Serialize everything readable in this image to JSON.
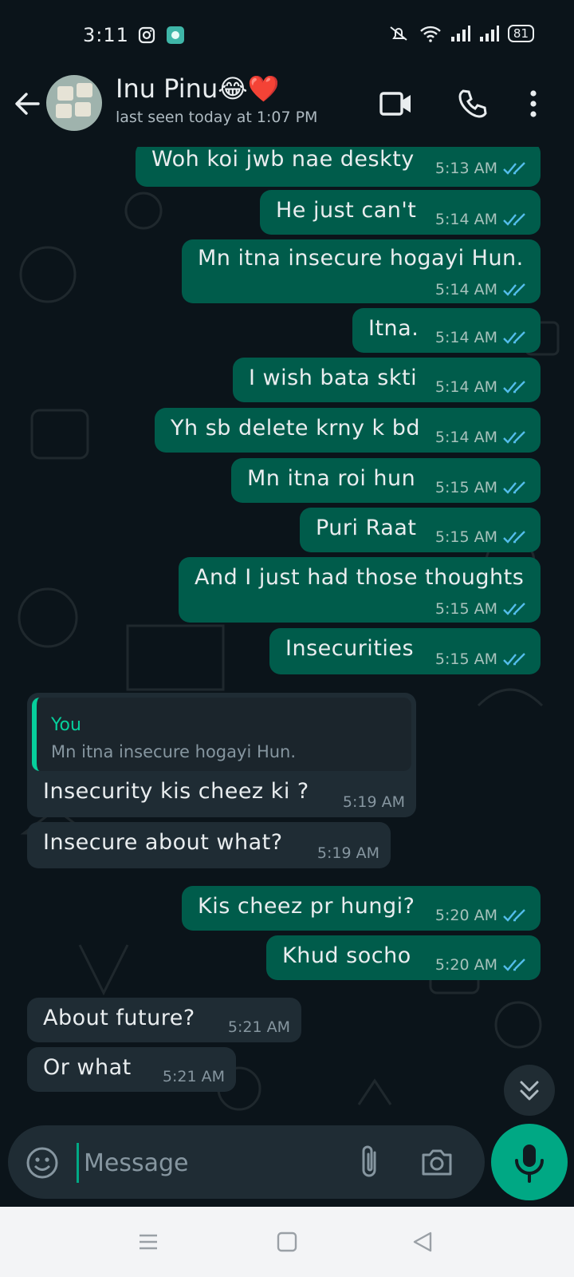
{
  "status_bar": {
    "time": "3:11",
    "battery": "81",
    "icons": [
      "instagram-icon",
      "app-notification-icon",
      "mute-icon",
      "wifi-icon",
      "signal-icon",
      "signal-icon-2",
      "battery-icon"
    ]
  },
  "header": {
    "contact_name": "Inu Pinu😂❤️",
    "last_seen": "last seen today at 1:07 PM",
    "icons": [
      "back-arrow-icon",
      "video-call-icon",
      "phone-call-icon",
      "more-options-icon"
    ]
  },
  "messages": [
    {
      "direction": "out",
      "text": "Woh koi jwb nae deskty",
      "time": "5:13 AM",
      "status": "read"
    },
    {
      "direction": "out",
      "text": "He just can't",
      "time": "5:14 AM",
      "status": "read"
    },
    {
      "direction": "out",
      "text": "Mn itna insecure hogayi Hun.",
      "time": "5:14 AM",
      "status": "read"
    },
    {
      "direction": "out",
      "text": "Itna.",
      "time": "5:14 AM",
      "status": "read"
    },
    {
      "direction": "out",
      "text": "I wish bata skti",
      "time": "5:14 AM",
      "status": "read"
    },
    {
      "direction": "out",
      "text": "Yh sb delete krny k bd",
      "time": "5:14 AM",
      "status": "read"
    },
    {
      "direction": "out",
      "text": "Mn itna roi hun",
      "time": "5:15 AM",
      "status": "read"
    },
    {
      "direction": "out",
      "text": "Puri Raat",
      "time": "5:15 AM",
      "status": "read"
    },
    {
      "direction": "out",
      "text": "And I just had those thoughts",
      "time": "5:15 AM",
      "status": "read"
    },
    {
      "direction": "out",
      "text": "Insecurities",
      "time": "5:15 AM",
      "status": "read"
    },
    {
      "direction": "in",
      "text": "Insecurity kis cheez ki ?",
      "time": "5:19 AM",
      "quote": {
        "author": "You",
        "text": "Mn itna insecure hogayi Hun."
      }
    },
    {
      "direction": "in",
      "text": "Insecure about what?",
      "time": "5:19 AM"
    },
    {
      "direction": "out",
      "text": "Kis cheez pr hungi?",
      "time": "5:20 AM",
      "status": "read"
    },
    {
      "direction": "out",
      "text": "Khud socho",
      "time": "5:20 AM",
      "status": "read"
    },
    {
      "direction": "in",
      "text": "About future?",
      "time": "5:21 AM"
    },
    {
      "direction": "in",
      "text": "Or what",
      "time": "5:21 AM"
    }
  ],
  "composer": {
    "placeholder": "Message",
    "icons": [
      "emoji-icon",
      "attach-icon",
      "camera-icon",
      "mic-icon"
    ]
  },
  "colors": {
    "background": "#0b141a",
    "outgoing_bubble": "#005c4b",
    "incoming_bubble": "#1f2c34",
    "accent": "#00a884",
    "read_ticks": "#53bdeb"
  }
}
